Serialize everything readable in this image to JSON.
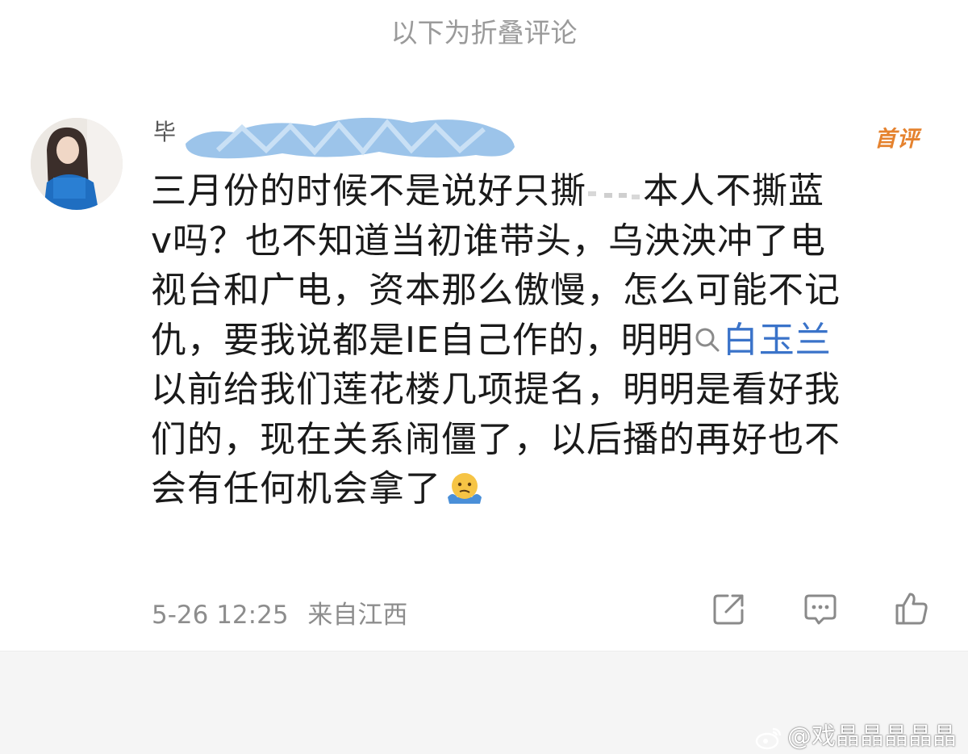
{
  "fold_header": "以下为折叠评论",
  "comment": {
    "username_visible": "毕",
    "badge": "首评",
    "lines": [
      "三月份的时候不是说好只撕",
      "本人不撕蓝",
      "v吗？也不知道当初谁带头，乌泱泱冲了电",
      "视台和广电，资本那么傲慢，怎么可能不记",
      "仇，要我说都是IE自己作的，明明",
      "白玉兰",
      "以前给我们莲花楼几项提名，明明是看好我",
      "们的，现在关系闹僵了，以后播的再好也不",
      "会有任何机会拿了"
    ],
    "time": "5-26 12:25",
    "location": "来自江西"
  },
  "actions": {
    "share_icon": "share-icon",
    "reply_icon": "comment-icon",
    "like_icon": "thumbs-up-icon"
  },
  "watermark": "@戏晶晶晶晶晶",
  "colors": {
    "mention": "#3a73c9",
    "badge": "#e5822e",
    "meta": "#8d8d8d",
    "redaction": "#9cc4ea"
  }
}
